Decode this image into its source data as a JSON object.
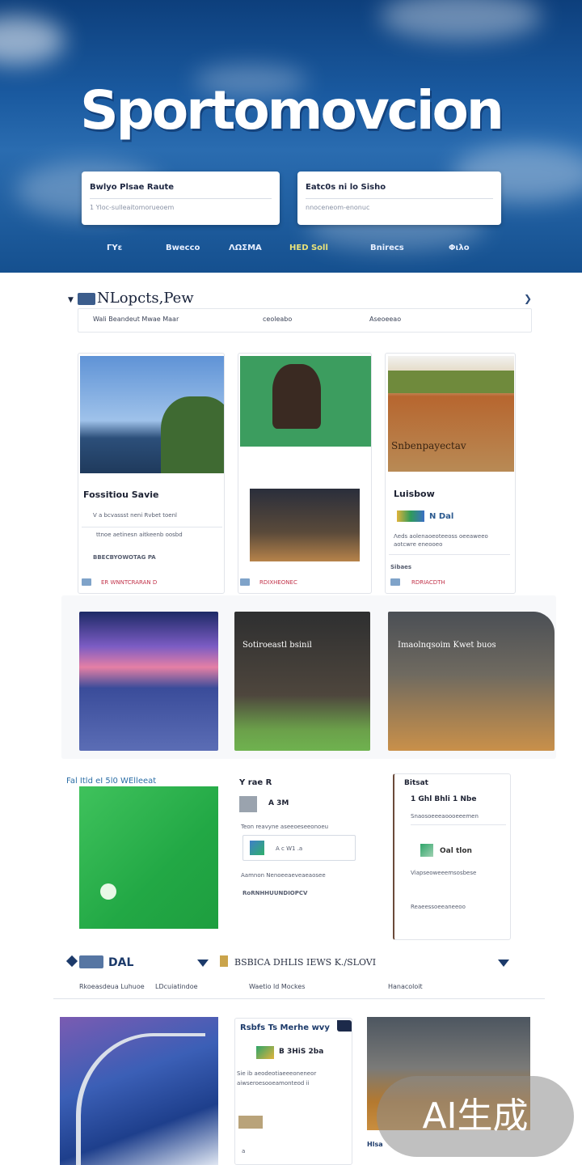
{
  "hero": {
    "title": "Sportomovcion",
    "card_left": {
      "title": "Bwlyo Plsae Raute",
      "subtitle": "1 Yloc-sulleaitomorueoem"
    },
    "card_right": {
      "title": "Eatc0s ni lo Sisho",
      "subtitle": "nnoceneom-enonuc"
    },
    "nav": [
      "ΓΥε",
      "Bwecco",
      "ΛΩΣΜΑ",
      "HED Soll",
      "Bnirecs",
      "Φιλο"
    ]
  },
  "section1": {
    "title": "NLopcts,Pew",
    "bar_items": [
      "Wali Beandeut Mwae Maar",
      "ceoleabo",
      "Aseoeeao"
    ]
  },
  "cards_row1": [
    {
      "heading": "Fossitiou Savie",
      "lines": [
        "V a bcvassst neni Rvbet toenl",
        "ttnoe aetinesn aitkeenb oosbd",
        "BBECBYOWOTAG PA"
      ],
      "footer": "ER WNNTCRARAN D"
    },
    {
      "heading": "",
      "lines": [],
      "footer": "RDIXHEONEC"
    },
    {
      "heading": "Luisbow",
      "sign": "Snbenpayectav",
      "badge": "N Dal",
      "lines": [
        "Λeds aolenaoeoteeoss oeeaweeo",
        "aotcwre eneooeo"
      ],
      "footer_left": "Sibaes",
      "footer": "RDRIACDTH"
    }
  ],
  "cards_row2": [
    {
      "caption": ""
    },
    {
      "caption": "Sotiroeastl bsinil"
    },
    {
      "caption": "Imaolnqsoim Kwet buos"
    }
  ],
  "cards_row3": [
    {
      "heading": "Fal Itld eI 5l0 WElleeat"
    },
    {
      "heading": "Y rae R",
      "sub": "A 3M",
      "lines": [
        "Teon reavyne aseeoeseeonoeu",
        "A c W1 .a",
        "Aamnon Nenoeeaeveaeaosee",
        "RoRNHHUUNDIOPCV"
      ]
    },
    {
      "heading": "Bitsat",
      "sub": "1 Ghl Bhli 1 Nbe",
      "badge": "Oal tlon",
      "lines": [
        "Snaosoeeeaoooeeemen",
        "Viapseoweeemsosbese",
        "Reaeessoeeaneeoo"
      ]
    }
  ],
  "section2": {
    "label": "DAL",
    "middle": "BSBICA DHLIS IEWS K./SLOVI",
    "subs": [
      "Rkoeasdeua Luhuoe",
      "LDcuiatindoe",
      "Waetio ld Mockes",
      "Hanacoloit"
    ]
  },
  "cards_row4": [
    {
      "heading": ""
    },
    {
      "heading": "Rsbfs Ts Merhe wvy",
      "badge": "B 3HiS 2ba ",
      "lines": [
        "Sie ib aeodeotiaeeeoneneor",
        "aiwseroesooeamonteod ii",
        "a"
      ]
    },
    {
      "footer": "Hlsa"
    }
  ],
  "watermark": "AI生成"
}
